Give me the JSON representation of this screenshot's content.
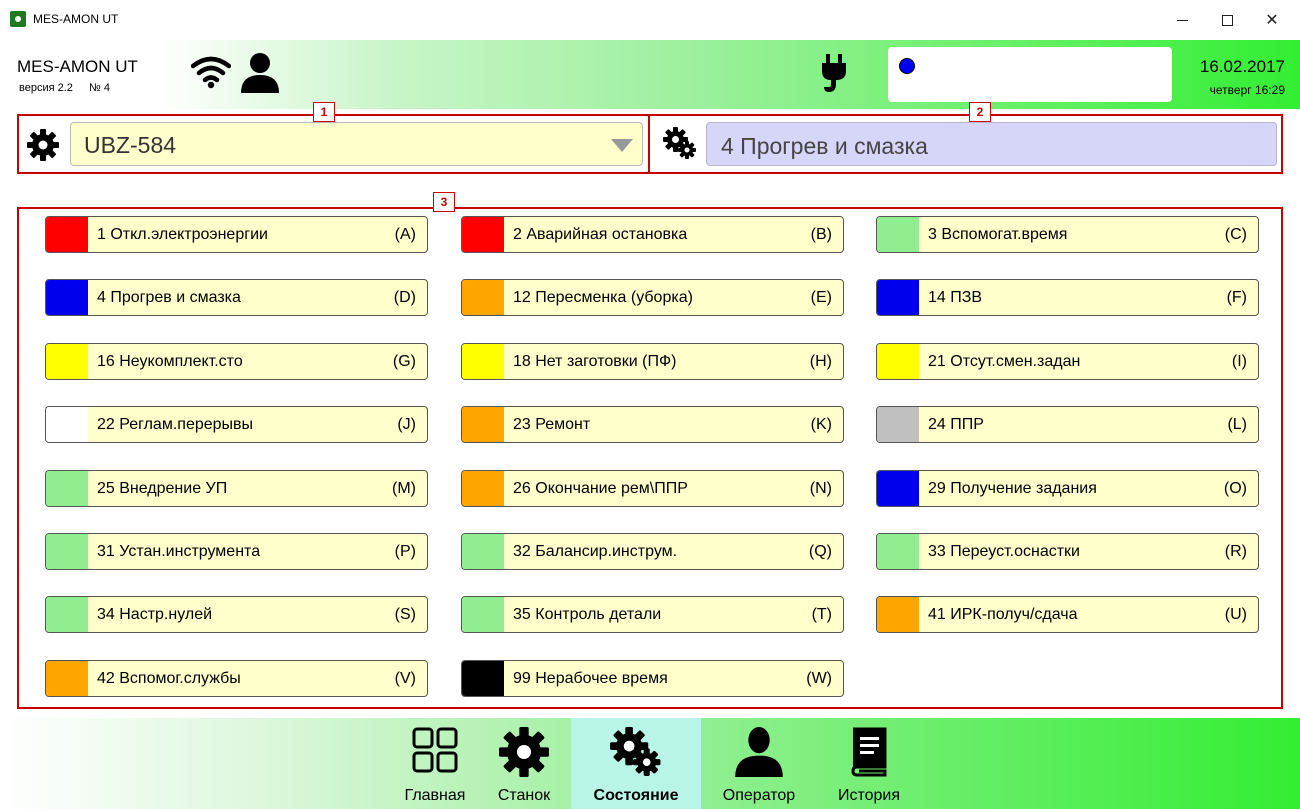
{
  "window": {
    "title": "MES-AMON UT"
  },
  "header": {
    "app_name": "MES-AMON UT",
    "version": "версия 2.2",
    "number": "№ 4",
    "date": "16.02.2017",
    "weekday_time": "четверг  16:29",
    "status_dot_color": "#0000ee"
  },
  "sections": {
    "n1": "1",
    "n2": "2",
    "n3": "3"
  },
  "machine": {
    "selected": "UBZ-584"
  },
  "current_state": {
    "label": "4 Прогрев и смазка"
  },
  "states": [
    {
      "label": "1 Откл.электроэнергии",
      "key": "(A)",
      "color": "#ff0000"
    },
    {
      "label": "2 Аварийная остановка",
      "key": "(B)",
      "color": "#ff0000"
    },
    {
      "label": "3 Вспомогат.время",
      "key": "(C)",
      "color": "#90ee90"
    },
    {
      "label": "4 Прогрев и смазка",
      "key": "(D)",
      "color": "#0000ee"
    },
    {
      "label": "12 Пересменка (уборка)",
      "key": "(E)",
      "color": "#ffa500"
    },
    {
      "label": "14 ПЗВ",
      "key": "(F)",
      "color": "#0000ee"
    },
    {
      "label": "16 Неукомплект.сто",
      "key": "(G)",
      "color": "#ffff00"
    },
    {
      "label": "18 Нет заготовки (ПФ)",
      "key": "(H)",
      "color": "#ffff00"
    },
    {
      "label": "21 Отсут.смен.задан",
      "key": "(I)",
      "color": "#ffff00"
    },
    {
      "label": "22 Реглам.перерывы",
      "key": "(J)",
      "color": "#ffffff"
    },
    {
      "label": "23 Ремонт",
      "key": "(K)",
      "color": "#ffa500"
    },
    {
      "label": "24 ППР",
      "key": "(L)",
      "color": "#c0c0c0"
    },
    {
      "label": "25 Внедрение УП",
      "key": "(M)",
      "color": "#90ee90"
    },
    {
      "label": "26 Окончание рем\\ППР",
      "key": "(N)",
      "color": "#ffa500"
    },
    {
      "label": "29 Получение задания",
      "key": "(O)",
      "color": "#0000ee"
    },
    {
      "label": "31 Устан.инструмента",
      "key": "(P)",
      "color": "#90ee90"
    },
    {
      "label": "32 Балансир.инструм.",
      "key": "(Q)",
      "color": "#90ee90"
    },
    {
      "label": "33 Переуст.оснастки",
      "key": "(R)",
      "color": "#90ee90"
    },
    {
      "label": "34 Настр.нулей",
      "key": "(S)",
      "color": "#90ee90"
    },
    {
      "label": "35 Контроль детали",
      "key": "(T)",
      "color": "#90ee90"
    },
    {
      "label": "41 ИРК-получ/сдача",
      "key": "(U)",
      "color": "#ffa500"
    },
    {
      "label": "42 Вспомог.службы",
      "key": "(V)",
      "color": "#ffa500"
    },
    {
      "label": "99 Нерабочее время",
      "key": "(W)",
      "color": "#000000"
    }
  ],
  "nav": {
    "home": "Главная",
    "machine": "Станок",
    "state": "Состояние",
    "operator": "Оператор",
    "history": "История",
    "active": "state",
    "active_color": "#b8f5e6"
  }
}
